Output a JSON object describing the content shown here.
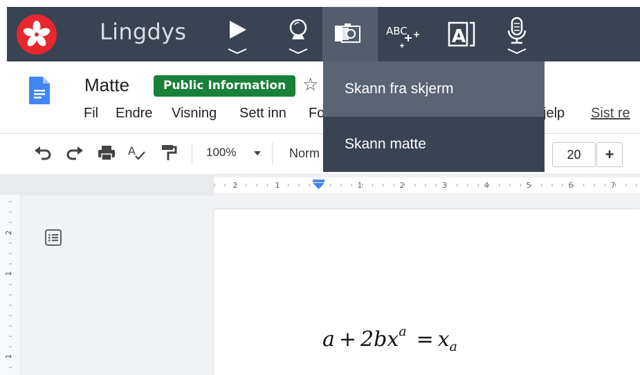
{
  "lingdys": {
    "app_name": "Lingdys",
    "tools": [
      {
        "name": "play-icon",
        "active": false
      },
      {
        "name": "crystal-ball-icon",
        "active": false
      },
      {
        "name": "camera-scan-icon",
        "active": true
      },
      {
        "name": "abc-sparkle-icon",
        "active": false
      },
      {
        "name": "text-a-icon",
        "active": false
      },
      {
        "name": "microphone-icon",
        "active": false
      }
    ],
    "colors": {
      "bar": "#3a4352",
      "active": "#545d6b",
      "logo": "#e8262d"
    }
  },
  "scan_menu": {
    "items": [
      "Skann fra skjerm",
      "Skann matte"
    ],
    "highlighted": "Skann fra skjerm"
  },
  "doc": {
    "title": "Matte",
    "badge": "Public Information",
    "menu": {
      "fil": "Fil",
      "endre": "Endre",
      "visning": "Visning",
      "sett_inn": "Sett inn",
      "format_fragment": "Fo",
      "help_fragment": "jelp",
      "last_edit_fragment": "Sist re"
    }
  },
  "format_toolbar": {
    "zoom": "100%",
    "style_fragment": "Norm",
    "font_size": "20",
    "plus": "+"
  },
  "ruler": {
    "left_marks": [
      "2",
      "1"
    ],
    "right_marks": [
      "1",
      "2",
      "3",
      "4",
      "5",
      "6",
      "7"
    ],
    "vertical_marks": [
      "2",
      "1",
      "1"
    ]
  },
  "equation": {
    "a": "a",
    "plus": "+",
    "coef": "2bx",
    "exp": "a",
    "equals": "=",
    "rhs": "x",
    "sub": "a"
  }
}
